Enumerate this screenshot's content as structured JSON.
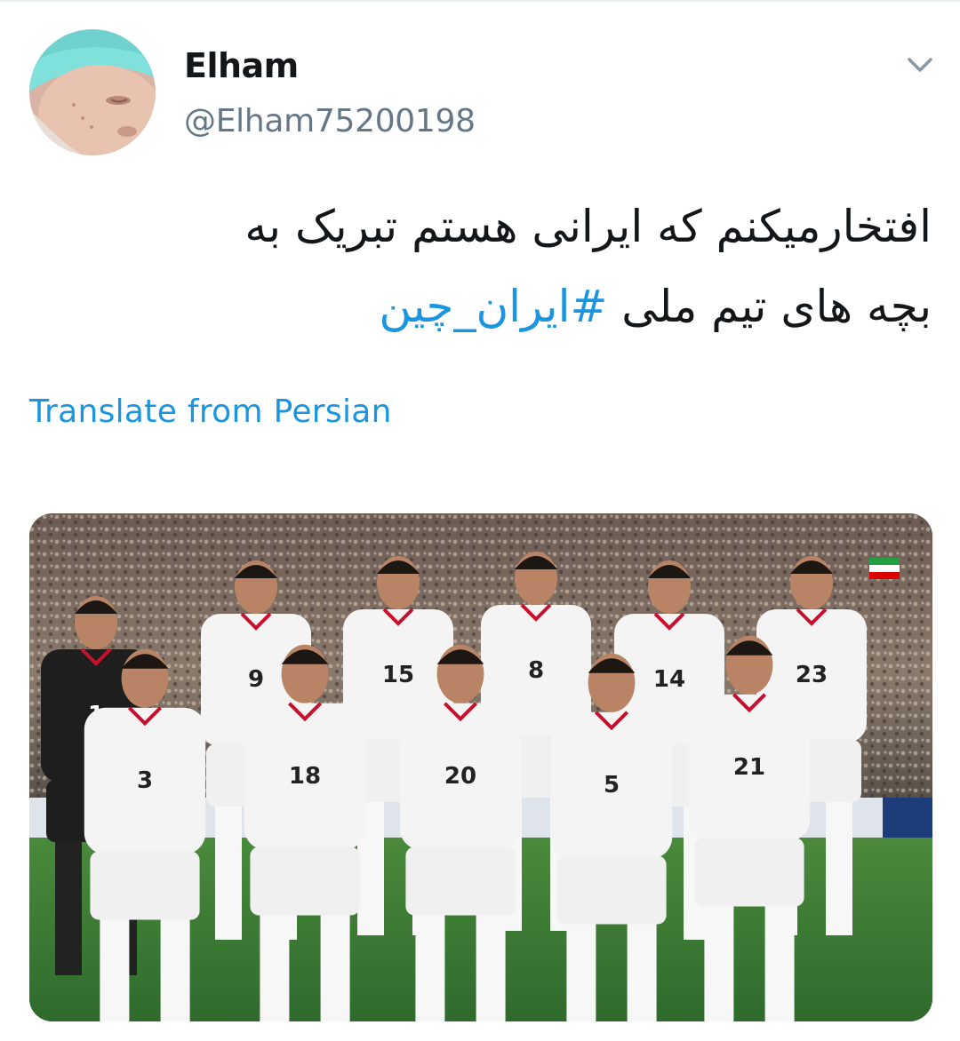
{
  "tweet": {
    "author": {
      "display_name": "Elham",
      "handle": "@Elham75200198",
      "avatar_icon": "baby-photo-avatar"
    },
    "menu_icon": "chevron-down-icon",
    "text_line_1": "افتخارمیکنم که ایرانی هستم تبریک به",
    "text_line_2_plain": "بچه های تیم ملی",
    "hashtag": "#ایران_چین",
    "translate_label": "Translate from Persian",
    "media": {
      "description_icon": "team-photo-image",
      "jersey_numbers": [
        "1",
        "9",
        "15",
        "8",
        "14",
        "3",
        "18",
        "20",
        "5",
        "21",
        "23"
      ]
    }
  },
  "colors": {
    "link": "#1b95e0",
    "text": "#14171a",
    "secondary": "#657786",
    "divider": "#e6ecf0"
  }
}
